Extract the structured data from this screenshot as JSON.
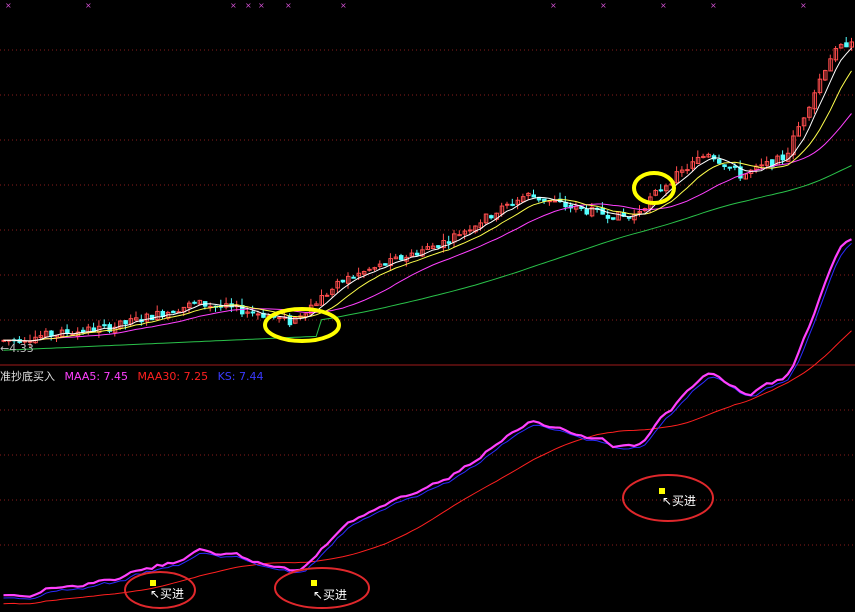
{
  "colors": {
    "background": "#000000",
    "up": "#ff4d4d",
    "down": "#54ffff",
    "ma5": "#ffffff",
    "ma10": "#ffff4c",
    "ma20": "#ff40ff",
    "ma60": "#2ac24a",
    "maa5": "#ff40ff",
    "maa30": "#ff2020",
    "ks": "#2a2aff",
    "circle_yellow": "#ffff00",
    "circle_red": "#e0282c",
    "marker": "#ffff00",
    "grid": "#8a1d1d",
    "low_label": "#c0c0c0",
    "divider": "#a01a1a"
  },
  "low_label": "←4.33",
  "indicator": {
    "name": "准抄底买入",
    "maa5_label": "MAA5: 7.45",
    "maa30_label": "MAA30: 7.25",
    "ks_label": "KS: 7.44"
  },
  "buy_label": "↖买进",
  "chart_data": [
    {
      "type": "candlestick",
      "panel": "price",
      "ylim": [
        4.2,
        11.3
      ],
      "n": 120,
      "low_value": 4.33,
      "ma_series": [
        "MA5",
        "MA10",
        "MA20",
        "MA60"
      ],
      "highlight_circles_bar_index": [
        50,
        113
      ],
      "buy_markers_bar_index": [
        26,
        50,
        113
      ]
    },
    {
      "type": "line",
      "panel": "indicator",
      "title": "准抄底买入",
      "series": [
        {
          "name": "MAA5",
          "last": 7.45
        },
        {
          "name": "MAA30",
          "last": 7.25
        },
        {
          "name": "KS",
          "last": 7.44
        }
      ],
      "ylim": [
        4.3,
        8.0
      ],
      "annotations": [
        "买进",
        "买进",
        "买进"
      ]
    }
  ]
}
